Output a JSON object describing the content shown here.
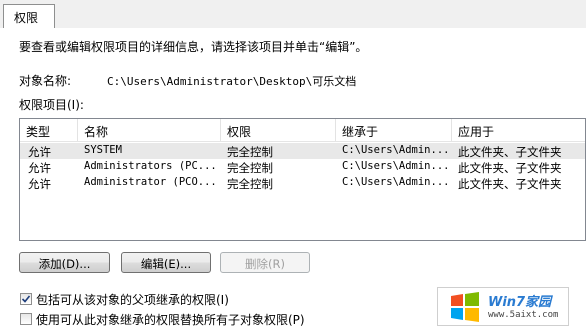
{
  "tab": {
    "label": "权限"
  },
  "instruction": "要查看或编辑权限项目的详细信息，请选择该项目并单击“编辑”。",
  "object_name": {
    "label": "对象名称:",
    "value": "C:\\Users\\Administrator\\Desktop\\可乐文档"
  },
  "entries_label": "权限项目(I):",
  "columns": [
    "类型",
    "名称",
    "权限",
    "继承于",
    "应用于"
  ],
  "rows": [
    {
      "type": "允许",
      "name": "SYSTEM",
      "permission": "完全控制",
      "inherited": "C:\\Users\\Admin...",
      "applies": "此文件夹、子文件夹"
    },
    {
      "type": "允许",
      "name": "Administrators (PC...",
      "permission": "完全控制",
      "inherited": "C:\\Users\\Admin...",
      "applies": "此文件夹、子文件夹"
    },
    {
      "type": "允许",
      "name": "Administrator (PCO...",
      "permission": "完全控制",
      "inherited": "C:\\Users\\Admin...",
      "applies": "此文件夹、子文件夹"
    }
  ],
  "buttons": {
    "add": "添加(D)...",
    "edit": "编辑(E)...",
    "remove": "删除(R)"
  },
  "checkboxes": [
    {
      "label": "包括可从该对象的父项继承的权限(I)",
      "checked": true
    },
    {
      "label": "使用可从此对象继承的权限替换所有子对象权限(P)",
      "checked": false
    }
  ],
  "watermark": {
    "brand": "Win7家园",
    "url": "www.5aixt.com"
  }
}
